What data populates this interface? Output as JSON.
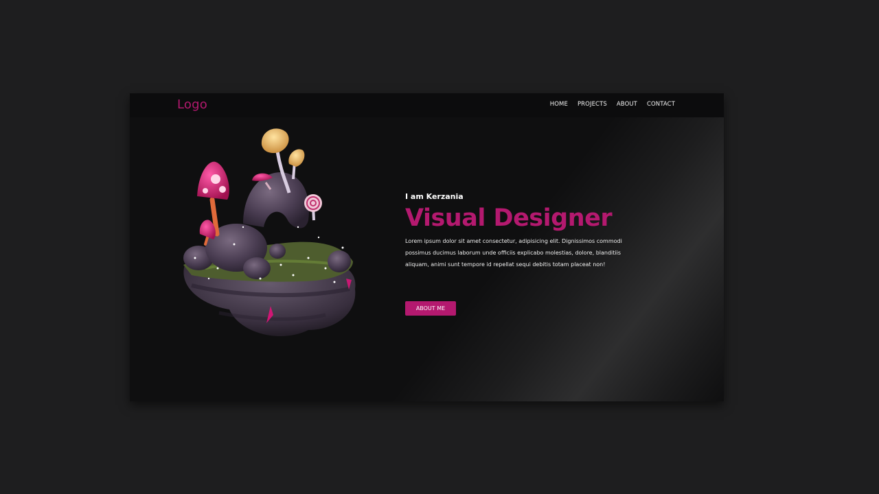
{
  "header": {
    "logo": "Logo",
    "nav": [
      "HOME",
      "PROJECTS",
      "ABOUT",
      "CONTACT"
    ]
  },
  "hero": {
    "intro": "I am Kerzania",
    "headline": "Visual Designer",
    "description": "Lorem ipsum dolor sit amet consectetur, adipisicing elit. Dignissimos commodi possimus ducimus laborum unde officiis explicabo molestias, dolore, blanditiis aliquam, animi sunt tempore id repellat sequi debitis totam placeat non!",
    "button_label": "ABOUT ME"
  },
  "illustration": {
    "icon": "floating-mushroom-island-illustration"
  },
  "colors": {
    "accent": "#b4196f",
    "page_background": "#1e1e1f",
    "frame_background": "#0f0f10"
  }
}
